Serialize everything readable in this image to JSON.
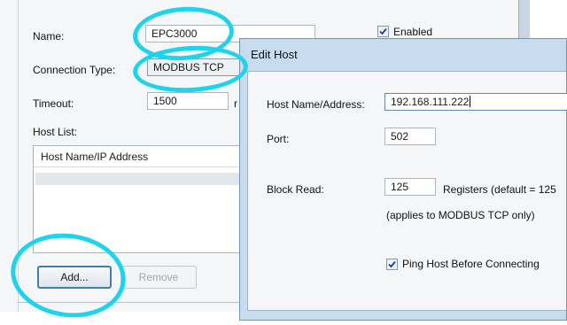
{
  "main": {
    "name_label": "Name:",
    "name_value": "EPC3000",
    "enabled_label": "Enabled",
    "enabled_checked": true,
    "connection_type_label": "Connection Type:",
    "connection_type_value": "MODBUS TCP",
    "timeout_label": "Timeout:",
    "timeout_value": "1500",
    "timeout_unit": "r",
    "host_list_label": "Host List:",
    "host_list_header": "Host Name/IP Address",
    "add_button": "Add...",
    "remove_button": "Remove"
  },
  "dialog": {
    "title": "Edit Host",
    "host_label": "Host Name/Address:",
    "host_value": "192.168.111.222",
    "port_label": "Port:",
    "port_value": "502",
    "block_read_label": "Block Read:",
    "block_read_value": "125",
    "registers_note": "Registers (default = 125",
    "applies_note": "(applies to MODBUS TCP only)",
    "ping_label": "Ping Host Before Connecting",
    "ping_checked": true
  },
  "colors": {
    "annotation_circle": "#1fd3ec",
    "dialog_frame": "#c7dcef"
  }
}
